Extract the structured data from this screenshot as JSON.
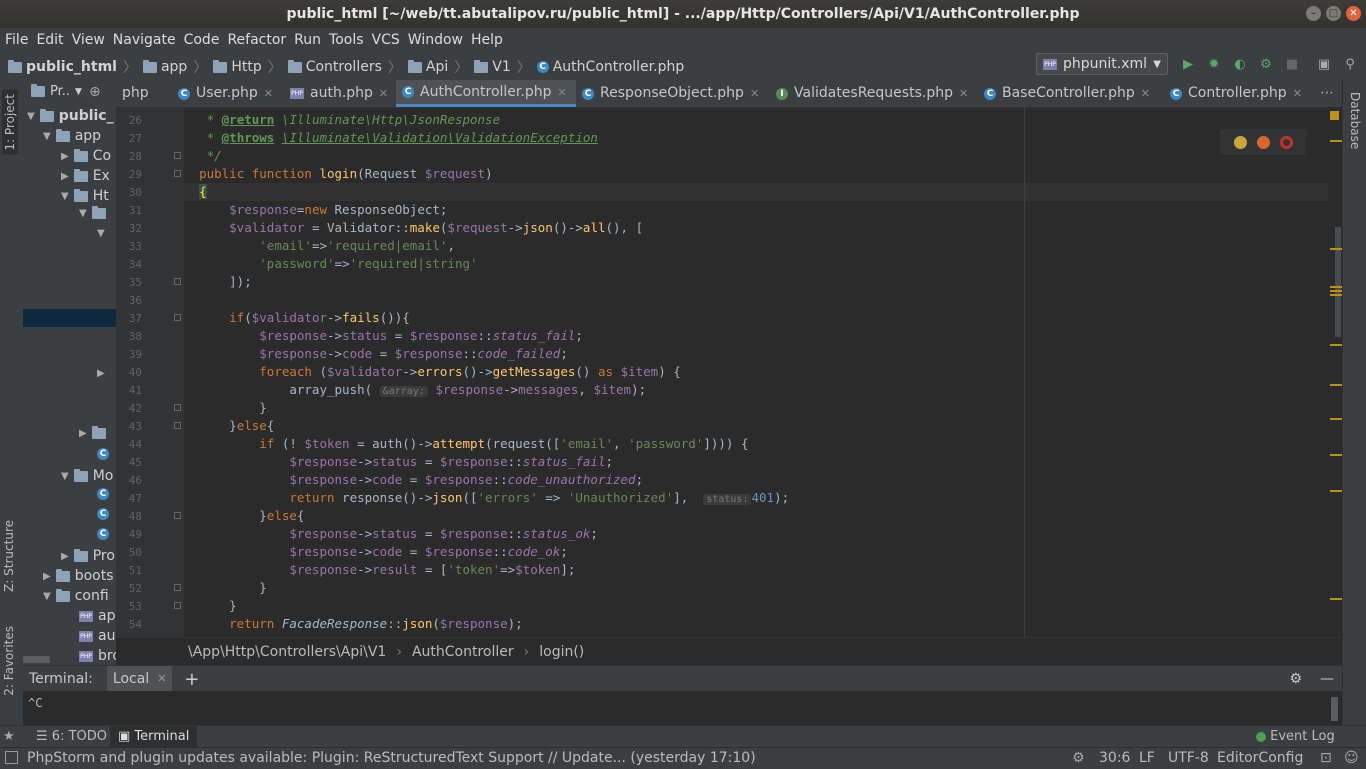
{
  "window": {
    "title": "public_html [~/web/tt.abutalipov.ru/public_html] - .../app/Http/Controllers/Api/V1/AuthController.php"
  },
  "menu": [
    "File",
    "Edit",
    "View",
    "Navigate",
    "Code",
    "Refactor",
    "Run",
    "Tools",
    "VCS",
    "Window",
    "Help"
  ],
  "breadcrumb": [
    "public_html",
    "app",
    "Http",
    "Controllers",
    "Api",
    "V1",
    "AuthController.php"
  ],
  "run_config": "phpunit.xml",
  "left_tabs": {
    "project": "1: Project",
    "structure": "Z: Structure",
    "favorites": "2: Favorites"
  },
  "right_tabs": {
    "database": "Database"
  },
  "project_panel": {
    "header": "Pr..",
    "items": [
      "public_",
      "app",
      "Co",
      "Ex",
      "Ht",
      "Mo",
      "Pro",
      "boots",
      "confi",
      "ap",
      "au",
      "bro"
    ]
  },
  "tabs": [
    "php",
    "User.php",
    "auth.php",
    "AuthController.php",
    "ResponseObject.php",
    "ValidatesRequests.php",
    "BaseController.php",
    "Controller.php"
  ],
  "line_numbers": [
    "26",
    "27",
    "28",
    "29",
    "30",
    "31",
    "32",
    "33",
    "34",
    "35",
    "36",
    "37",
    "38",
    "39",
    "40",
    "41",
    "42",
    "43",
    "44",
    "45",
    "46",
    "47",
    "48",
    "49",
    "50",
    "51",
    "52",
    "53",
    "54"
  ],
  "code_tokens": {
    "return_tag": "@return",
    "return_type": "\\Illuminate\\Http\\JsonResponse",
    "throws_tag": "@throws",
    "throws_type": "\\Illuminate\\Validation\\ValidationException",
    "hint_array": "&array:",
    "hint_status": "status:"
  },
  "code_crumbs": [
    "\\App\\Http\\Controllers\\Api\\V1",
    "AuthController",
    "login()"
  ],
  "terminal": {
    "title": "Terminal:",
    "tab": "Local",
    "output": "^C"
  },
  "bottom_tools": {
    "todo": "6: TODO",
    "terminal": "Terminal",
    "event_log": "Event Log"
  },
  "status": {
    "message": "PhpStorm and plugin updates available: Plugin: ReStructuredText Support // Update... (yesterday 17:10)",
    "position": "30:6",
    "line_sep": "LF",
    "encoding": "UTF-8",
    "editor_config": "EditorConfig"
  },
  "colors": {
    "accent": "#4a88c7",
    "keyword": "#cc7832",
    "string": "#6a8759",
    "variable": "#9876aa",
    "function": "#ffc66d"
  }
}
